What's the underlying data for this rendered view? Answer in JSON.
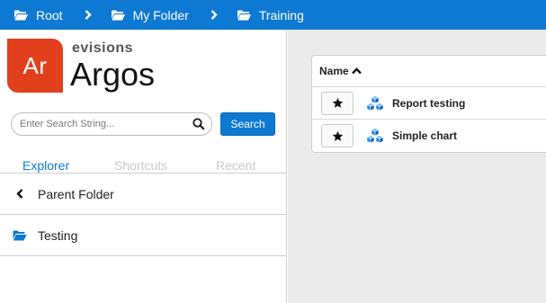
{
  "breadcrumb": {
    "items": [
      {
        "label": "Root",
        "icon": "folder-open-icon"
      },
      {
        "label": "My Folder",
        "icon": "folder-open-icon"
      },
      {
        "label": "Training",
        "icon": "folder-open-icon"
      }
    ],
    "separator_icon": "chevron-right-icon"
  },
  "brand": {
    "tile_text": "Ar",
    "company": "evisions",
    "product": "Argos"
  },
  "search": {
    "placeholder": "Enter Search String...",
    "value": "",
    "button_label": "Search"
  },
  "tabs": [
    {
      "label": "Explorer",
      "active": true
    },
    {
      "label": "Shortcuts",
      "active": false
    },
    {
      "label": "Recent",
      "active": false
    }
  ],
  "nav": {
    "parent_label": "Parent Folder",
    "folders": [
      {
        "label": "Testing"
      }
    ]
  },
  "list": {
    "column_header": "Name",
    "sort": "ascending",
    "rows": [
      {
        "name": "Report testing",
        "icon": "datablock-cubes-icon"
      },
      {
        "name": "Simple chart",
        "icon": "datablock-cubes-icon"
      }
    ]
  },
  "colors": {
    "accent": "#0e79d3",
    "brand": "#e2401c",
    "panel_bg": "#ebebeb"
  }
}
